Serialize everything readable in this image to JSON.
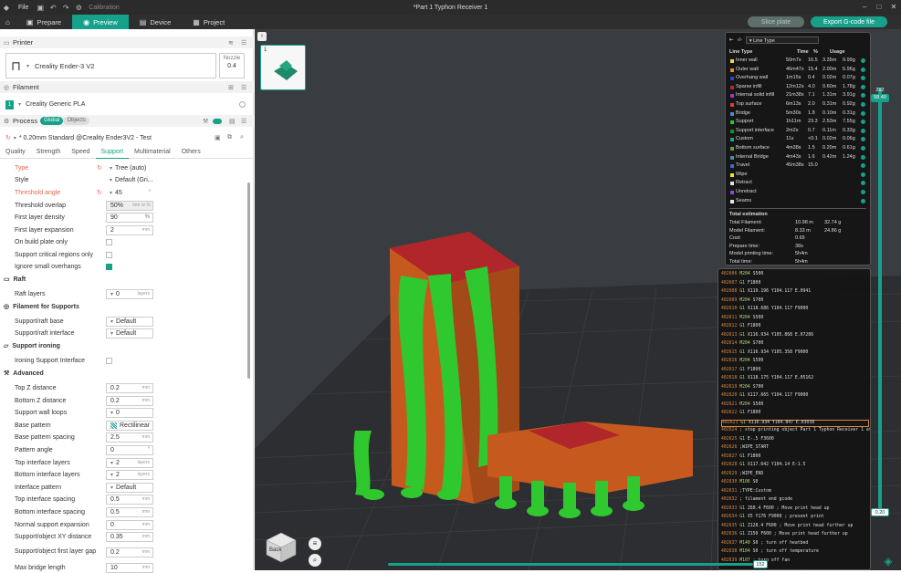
{
  "titlebar": {
    "file": "File",
    "calibration": "Calibration",
    "title": "*Part 1 Typhon Receiver 1"
  },
  "tabs": [
    {
      "label": "Prepare",
      "icon": "cube-icon"
    },
    {
      "label": "Preview",
      "icon": "eye-icon"
    },
    {
      "label": "Device",
      "icon": "device-icon"
    },
    {
      "label": "Project",
      "icon": "project-icon"
    }
  ],
  "actions": {
    "slice": "Slice plate",
    "export": "Export G-code file"
  },
  "printer": {
    "section": "Printer",
    "name": "Creality Ender-3 V2",
    "nozzle_label": "Nozzle",
    "nozzle_value": "0.4"
  },
  "filament": {
    "section": "Filament",
    "slot": "1",
    "name": "Creality Generic PLA"
  },
  "process": {
    "section": "Process",
    "global": "Global",
    "objects": "Objects",
    "preset": "* 0.20mm Standard @Creality Ender3V2 - Test"
  },
  "subtabs": [
    "Quality",
    "Strength",
    "Speed",
    "Support",
    "Multimaterial",
    "Others"
  ],
  "settings": {
    "type": {
      "label": "Type",
      "value": "Tree (auto)"
    },
    "style": {
      "label": "Style",
      "value": "Default (Gri..."
    },
    "threshold_angle": {
      "label": "Threshold angle",
      "value": "45"
    },
    "threshold_overlap": {
      "label": "Threshold overlap",
      "value": "50%",
      "unit": "mm or %"
    },
    "first_layer_density": {
      "label": "First layer density",
      "value": "90",
      "unit": "%"
    },
    "first_layer_expansion": {
      "label": "First layer expansion",
      "value": "2",
      "unit": "mm"
    },
    "on_build_plate": {
      "label": "On build plate only"
    },
    "critical_regions": {
      "label": "Support critical regions only"
    },
    "ignore_small": {
      "label": "Ignore small overhangs"
    },
    "raft_group": "Raft",
    "raft_layers": {
      "label": "Raft layers",
      "value": "0",
      "unit": "layers"
    },
    "filament_group": "Filament for Supports",
    "raft_base": {
      "label": "Support/raft base",
      "value": "Default"
    },
    "raft_interface": {
      "label": "Support/raft interface",
      "value": "Default"
    },
    "ironing_group": "Support ironing",
    "ironing_interface": {
      "label": "Ironing Support Interface"
    },
    "advanced_group": "Advanced",
    "top_z": {
      "label": "Top Z distance",
      "value": "0.2",
      "unit": "mm"
    },
    "bottom_z": {
      "label": "Bottom Z distance",
      "value": "0.2",
      "unit": "mm"
    },
    "wall_loops": {
      "label": "Support wall loops",
      "value": "0"
    },
    "base_pattern": {
      "label": "Base pattern",
      "value": "Rectilinear"
    },
    "base_spacing": {
      "label": "Base pattern spacing",
      "value": "2.5",
      "unit": "mm"
    },
    "pattern_angle": {
      "label": "Pattern angle",
      "value": "0"
    },
    "top_interface_layers": {
      "label": "Top interface layers",
      "value": "2",
      "unit": "layers"
    },
    "bottom_interface_layers": {
      "label": "Bottom interface layers",
      "value": "2",
      "unit": "layers"
    },
    "interface_pattern": {
      "label": "Interface pattern",
      "value": "Default"
    },
    "top_interface_spacing": {
      "label": "Top interface spacing",
      "value": "0.5",
      "unit": "mm"
    },
    "bottom_interface_spacing": {
      "label": "Bottom interface spacing",
      "value": "0.5",
      "unit": "mm"
    },
    "normal_expansion": {
      "label": "Normal support expansion",
      "value": "0",
      "unit": "mm"
    },
    "xy_distance": {
      "label": "Support/object XY distance",
      "value": "0.35",
      "unit": "mm"
    },
    "first_layer_gap": {
      "label": "Support/object first layer gap",
      "value": "0.2",
      "unit": "mm"
    },
    "max_bridge": {
      "label": "Max bridge length",
      "value": "10",
      "unit": "mm"
    }
  },
  "legend": {
    "selector": "Line Type",
    "columns": [
      "Line Type",
      "Time",
      "%",
      "Usage"
    ],
    "rows": [
      {
        "name": "Inner wall",
        "time": "50m7s",
        "pct": "16.5",
        "len": "3.35m",
        "w": "9.99g",
        "color": "#e6d84a"
      },
      {
        "name": "Outer wall",
        "time": "46m47s",
        "pct": "15.4",
        "len": "2.00m",
        "w": "5.96g",
        "color": "#e8843a"
      },
      {
        "name": "Overhang wall",
        "time": "1m15s",
        "pct": "0.4",
        "len": "0.02m",
        "w": "0.07g",
        "color": "#2c46c9"
      },
      {
        "name": "Sparse infill",
        "time": "12m12s",
        "pct": "4.0",
        "len": "0.60m",
        "w": "1.78g",
        "color": "#b2263a"
      },
      {
        "name": "Internal solid infill",
        "time": "21m38s",
        "pct": "7.1",
        "len": "1.31m",
        "w": "3.91g",
        "color": "#9a3ac9"
      },
      {
        "name": "Top surface",
        "time": "6m13s",
        "pct": "2.0",
        "len": "0.31m",
        "w": "0.92g",
        "color": "#e43a3a"
      },
      {
        "name": "Bridge",
        "time": "5m30s",
        "pct": "1.8",
        "len": "0.10m",
        "w": "0.31g",
        "color": "#4a8ac9"
      },
      {
        "name": "Support",
        "time": "1h11m",
        "pct": "23.3",
        "len": "2.53m",
        "w": "7.55g",
        "color": "#29c72c"
      },
      {
        "name": "Support interface",
        "time": "2m2s",
        "pct": "0.7",
        "len": "0.11m",
        "w": "0.33g",
        "color": "#1f8a2a"
      },
      {
        "name": "Custom",
        "time": "11s",
        "pct": "<0.1",
        "len": "0.02m",
        "w": "0.06g",
        "color": "#2a9a8a"
      },
      {
        "name": "Bottom surface",
        "time": "4m38s",
        "pct": "1.5",
        "len": "0.20m",
        "w": "0.61g",
        "color": "#6a9a3a"
      },
      {
        "name": "Internal Bridge",
        "time": "4m43s",
        "pct": "1.6",
        "len": "0.42m",
        "w": "1.24g",
        "color": "#4a8aa8"
      },
      {
        "name": "Travel",
        "time": "45m38s",
        "pct": "15.0",
        "len": "",
        "w": "",
        "color": "#3a6ad6"
      },
      {
        "name": "Wipe",
        "time": "",
        "pct": "",
        "len": "",
        "w": "",
        "color": "#e6e63a"
      },
      {
        "name": "Retract",
        "time": "",
        "pct": "",
        "len": "",
        "w": "",
        "color": "#e0e0e0"
      },
      {
        "name": "Unretract",
        "time": "",
        "pct": "",
        "len": "",
        "w": "",
        "color": "#8a4ad6"
      },
      {
        "name": "Seams",
        "time": "",
        "pct": "",
        "len": "",
        "w": "",
        "color": "#e6e6e6"
      }
    ],
    "estimation_title": "Total estimation",
    "estimation": [
      {
        "k": "Total Filament:",
        "a": "10.98 m",
        "b": "32.74 g"
      },
      {
        "k": "Model Filament:",
        "a": "8.33 m",
        "b": "24.86 g"
      },
      {
        "k": "Cost:",
        "a": "0.65",
        "b": ""
      },
      {
        "k": "Prepare time:",
        "a": "38s",
        "b": ""
      },
      {
        "k": "Model printing time:",
        "a": "5h4m",
        "b": ""
      },
      {
        "k": "Total time:",
        "a": "5h4m",
        "b": ""
      }
    ]
  },
  "gcode": [
    {
      "ln": "402606",
      "cmd": "M204",
      "rest": " S500"
    },
    {
      "ln": "402607",
      "cmd": "G1",
      "rest": " F1800"
    },
    {
      "ln": "402608",
      "cmd": "G1",
      "rest": " X119.196 Y104.117 E.0941"
    },
    {
      "ln": "402609",
      "cmd": "M204",
      "rest": " S700"
    },
    {
      "ln": "402610",
      "cmd": "G1",
      "rest": " X118.686 Y104.117 F9000"
    },
    {
      "ln": "402611",
      "cmd": "M204",
      "rest": " S500"
    },
    {
      "ln": "402612",
      "cmd": "G1",
      "rest": " F1800"
    },
    {
      "ln": "402613",
      "cmd": "G1",
      "rest": " X116.934 Y105.868 E.07286"
    },
    {
      "ln": "402614",
      "cmd": "M204",
      "rest": " S700"
    },
    {
      "ln": "402615",
      "cmd": "G1",
      "rest": " X116.934 Y105.358 F9000"
    },
    {
      "ln": "402616",
      "cmd": "M204",
      "rest": " S500"
    },
    {
      "ln": "402617",
      "cmd": "G1",
      "rest": " F1800"
    },
    {
      "ln": "402618",
      "cmd": "G1",
      "rest": " X118.175 Y104.117 E.05162"
    },
    {
      "ln": "402619",
      "cmd": "M204",
      "rest": " S700"
    },
    {
      "ln": "402620",
      "cmd": "G1",
      "rest": " X117.665 Y104.117 F9000"
    },
    {
      "ln": "402621",
      "cmd": "M204",
      "rest": " S500"
    },
    {
      "ln": "402622",
      "cmd": "G1",
      "rest": " F1800"
    },
    {
      "ln": "402623",
      "cmd": "G1",
      "rest": " X116.934 Y104.847 E.03038"
    },
    {
      "ln": "402624",
      "cmd": "",
      "rest": "; stop printing object Part 1 Typhon Receiver 1 at..."
    },
    {
      "ln": "402625",
      "cmd": "G1",
      "rest": " E-.5 F3600"
    },
    {
      "ln": "402626",
      "cmd": "",
      "rest": ";WIPE_START"
    },
    {
      "ln": "402627",
      "cmd": "G1",
      "rest": " F1800"
    },
    {
      "ln": "402628",
      "cmd": "G1",
      "rest": " X117.642 Y104.14 E-1.5"
    },
    {
      "ln": "402629",
      "cmd": "",
      "rest": ";WIPE_END"
    },
    {
      "ln": "402630",
      "cmd": "M106",
      "rest": " S0"
    },
    {
      "ln": "402631",
      "cmd": "",
      "rest": ";TYPE:Custom"
    },
    {
      "ln": "402632",
      "cmd": "",
      "rest": "; filament end gcode"
    },
    {
      "ln": "402633",
      "cmd": "G1",
      "rest": " Z60.4 F600 ; Move print head up"
    },
    {
      "ln": "402634",
      "cmd": "G1",
      "rest": " X5 Y176 F9000 ; present print"
    },
    {
      "ln": "402635",
      "cmd": "G1",
      "rest": " Z128.4 F600 ; Move print head further up"
    },
    {
      "ln": "402636",
      "cmd": "G1",
      "rest": " Z150 F600 ; Move print head further up"
    },
    {
      "ln": "402637",
      "cmd": "M140",
      "rest": " S0 ; turn off heatbed"
    },
    {
      "ln": "402638",
      "cmd": "M104",
      "rest": " S0 ; turn off temperature"
    },
    {
      "ln": "402639",
      "cmd": "M107",
      "rest": " ; turn off fan"
    }
  ],
  "sliders": {
    "top_layer": "292",
    "top_height": "58.40",
    "bottom_height": "0.20",
    "horizontal": "152"
  },
  "viewcube": {
    "label": "Back"
  },
  "plate": {
    "number": "1"
  }
}
